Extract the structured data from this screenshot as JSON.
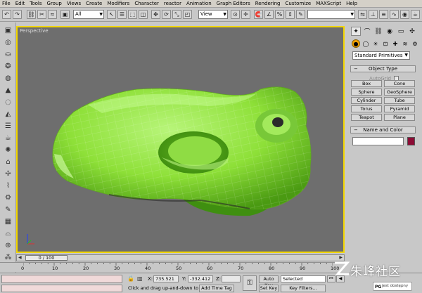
{
  "menu": [
    "File",
    "Edit",
    "Tools",
    "Group",
    "Views",
    "Create",
    "Modifiers",
    "Character",
    "reactor",
    "Animation",
    "Graph Editors",
    "Rendering",
    "Customize",
    "MAXScript",
    "Help"
  ],
  "toolbar": {
    "selection_filter": "All",
    "reference_coord": "View"
  },
  "viewport": {
    "label": "Perspective"
  },
  "command_panel": {
    "primitive_type": "Standard Primitives",
    "rollout_object_type": "Object Type",
    "autogrid_label": "AutoGrid",
    "buttons": [
      "Box",
      "Cone",
      "Sphere",
      "GeoSphere",
      "Cylinder",
      "Tube",
      "Torus",
      "Pyramid",
      "Teapot",
      "Plane"
    ],
    "rollout_name_color": "Name and Color",
    "object_color": "#8c0c35"
  },
  "time_slider": {
    "frame": "0 / 100"
  },
  "track_bar": {
    "ticks": [
      "0",
      "10",
      "20",
      "30",
      "40",
      "50",
      "60",
      "70",
      "80",
      "90",
      "100"
    ]
  },
  "status_bar": {
    "x_label": "X:",
    "x_value": "735.521",
    "y_label": "Y:",
    "y_value": "-332.412",
    "z_label": "Z:",
    "prompt": "Click and drag up-and-down to zoo",
    "add_time_tag": "Add Time Tag",
    "auto_key": "Auto Key",
    "set_key": "Set Key",
    "key_mode": "Selected",
    "key_filters": "Key Filters..."
  },
  "watermark": {
    "site": "朱峰社区",
    "badge": "jest dostępny",
    "badge_logo": "PG"
  },
  "colors": {
    "viewport_bg": "#6e6e6e",
    "active_border": "#f2d600",
    "model_green": "#8ee038"
  }
}
